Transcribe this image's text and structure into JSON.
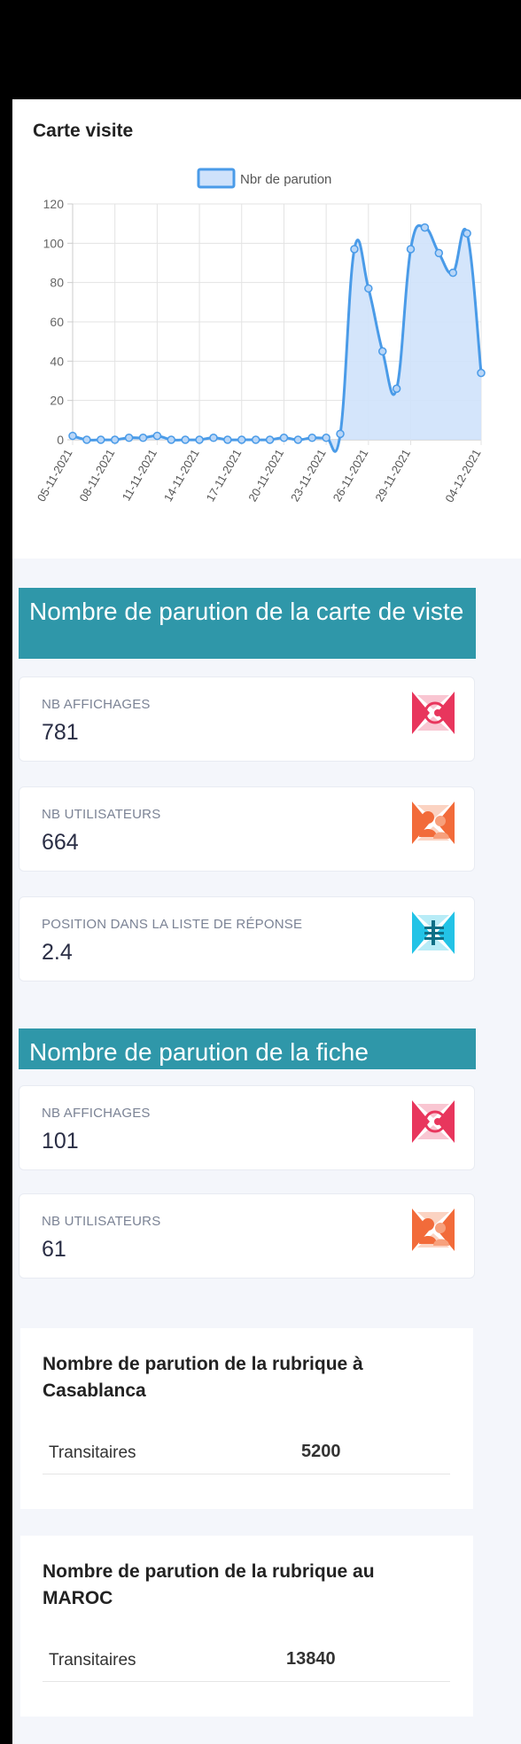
{
  "chart_card": {
    "title": "Carte visite"
  },
  "chart_data": {
    "type": "line",
    "title": "",
    "legend": {
      "label": "Nbr de parution",
      "position": "top"
    },
    "fill": true,
    "grid": true,
    "line_color": "#4a9be8",
    "fill_color": "#cfe2fb",
    "ylim": [
      0,
      120
    ],
    "yticks": [
      "0",
      "20",
      "40",
      "60",
      "80",
      "100",
      "120"
    ],
    "x": [
      "05-11-2021",
      "06-11-2021",
      "07-11-2021",
      "08-11-2021",
      "09-11-2021",
      "10-11-2021",
      "11-11-2021",
      "12-11-2021",
      "13-11-2021",
      "14-11-2021",
      "15-11-2021",
      "16-11-2021",
      "17-11-2021",
      "18-11-2021",
      "19-11-2021",
      "20-11-2021",
      "21-11-2021",
      "22-11-2021",
      "23-11-2021",
      "24-11-2021",
      "25-11-2021",
      "26-11-2021",
      "27-11-2021",
      "28-11-2021",
      "29-11-2021",
      "30-11-2021",
      "01-12-2021",
      "02-12-2021",
      "03-12-2021",
      "04-12-2021"
    ],
    "xtick_labels": [
      "05-11-2021",
      "08-11-2021",
      "11-11-2021",
      "14-11-2021",
      "17-11-2021",
      "20-11-2021",
      "23-11-2021",
      "26-11-2021",
      "29-11-2021",
      "04-12-2021"
    ],
    "series": [
      {
        "name": "Nbr de parution",
        "values": [
          2,
          0,
          0,
          0,
          1,
          1,
          2,
          0,
          0,
          0,
          1,
          0,
          0,
          0,
          0,
          1,
          0,
          1,
          1,
          3,
          97,
          77,
          45,
          26,
          97,
          108,
          95,
          85,
          105,
          34
        ]
      }
    ]
  },
  "section1": {
    "title": "Nombre de parution de la carte de viste",
    "cards": [
      {
        "label": "NB AFFICHAGES",
        "value": "781",
        "icon": "eye-icon",
        "color": "#e8365d"
      },
      {
        "label": "NB UTILISATEURS",
        "value": "664",
        "icon": "users-icon",
        "color": "#f26b3a"
      },
      {
        "label": "POSITION DANS LA LISTE DE RÉPONSE",
        "value": "2.4",
        "icon": "list-position-icon",
        "color": "#23c3e6"
      }
    ]
  },
  "section2": {
    "title": "Nombre de parution de la fiche",
    "cards": [
      {
        "label": "NB AFFICHAGES",
        "value": "101",
        "icon": "eye-icon",
        "color": "#e8365d"
      },
      {
        "label": "NB UTILISATEURS",
        "value": "61",
        "icon": "users-icon",
        "color": "#f26b3a"
      }
    ]
  },
  "rubrique_casablanca": {
    "title": "Nombre de parution de la rubrique à Casablanca",
    "rows": [
      {
        "name": "Transitaires",
        "value": "5200"
      }
    ]
  },
  "rubrique_maroc": {
    "title": "Nombre de parution de la rubrique au MAROC",
    "rows": [
      {
        "name": "Transitaires",
        "value": "13840"
      }
    ]
  }
}
